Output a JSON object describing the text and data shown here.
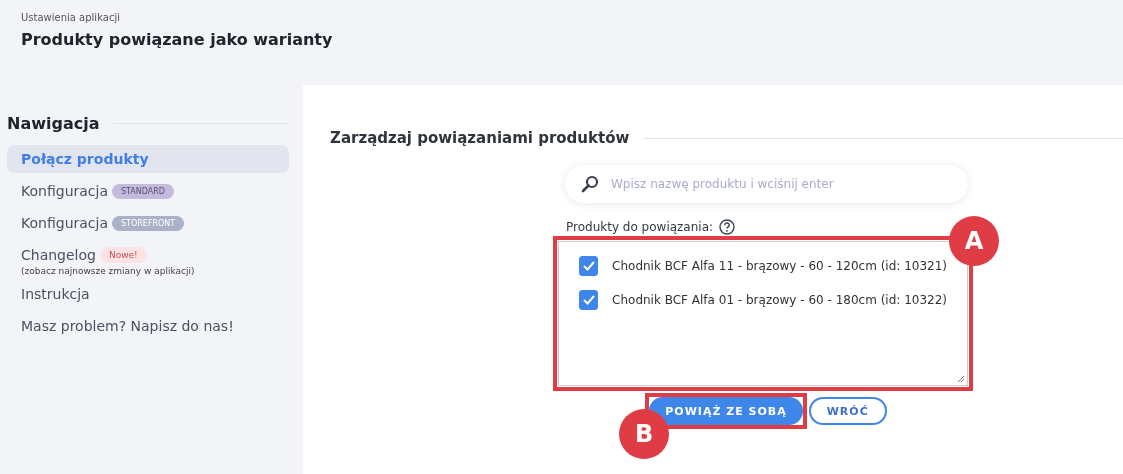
{
  "header": {
    "breadcrumb": "Ustawienia aplikacji",
    "title": "Produkty powiązane jako warianty"
  },
  "sidebar": {
    "title": "Nawigacja",
    "items": [
      {
        "label": "Połącz produkty",
        "selected": true
      },
      {
        "label": "Konfiguracja",
        "selected": false,
        "badge": {
          "text": "STANDARD",
          "kind": "standard"
        }
      },
      {
        "label": "Konfiguracja",
        "selected": false,
        "badge": {
          "text": "STOREFRONT",
          "kind": "storefront"
        }
      },
      {
        "label": "Changelog",
        "selected": false,
        "badge": {
          "text": "Nowe!",
          "kind": "new"
        },
        "note": "(zobacz najnowsze zmiany w aplikacji)"
      },
      {
        "label": "Instrukcja",
        "selected": false
      },
      {
        "label": "Masz problem? Napisz do nas!",
        "selected": false
      }
    ]
  },
  "main": {
    "title": "Zarządzaj powiązaniami produktów",
    "search": {
      "placeholder": "Wpisz nazwę produktu i wciśnij enter"
    },
    "list_label": "Produkty do powiązania:",
    "products": [
      {
        "label": "Chodnik BCF Alfa 11 - brązowy - 60 - 120cm (id: 10321)",
        "checked": true
      },
      {
        "label": "Chodnik BCF Alfa 01 - brązowy - 60 - 180cm (id: 10322)",
        "checked": true
      }
    ],
    "buttons": [
      {
        "label": "POWIĄŻ ZE SOBĄ",
        "kind": "primary"
      },
      {
        "label": "WRÓĆ",
        "kind": "secondary"
      }
    ]
  },
  "annotations": [
    {
      "label": "A"
    },
    {
      "label": "B"
    }
  ]
}
